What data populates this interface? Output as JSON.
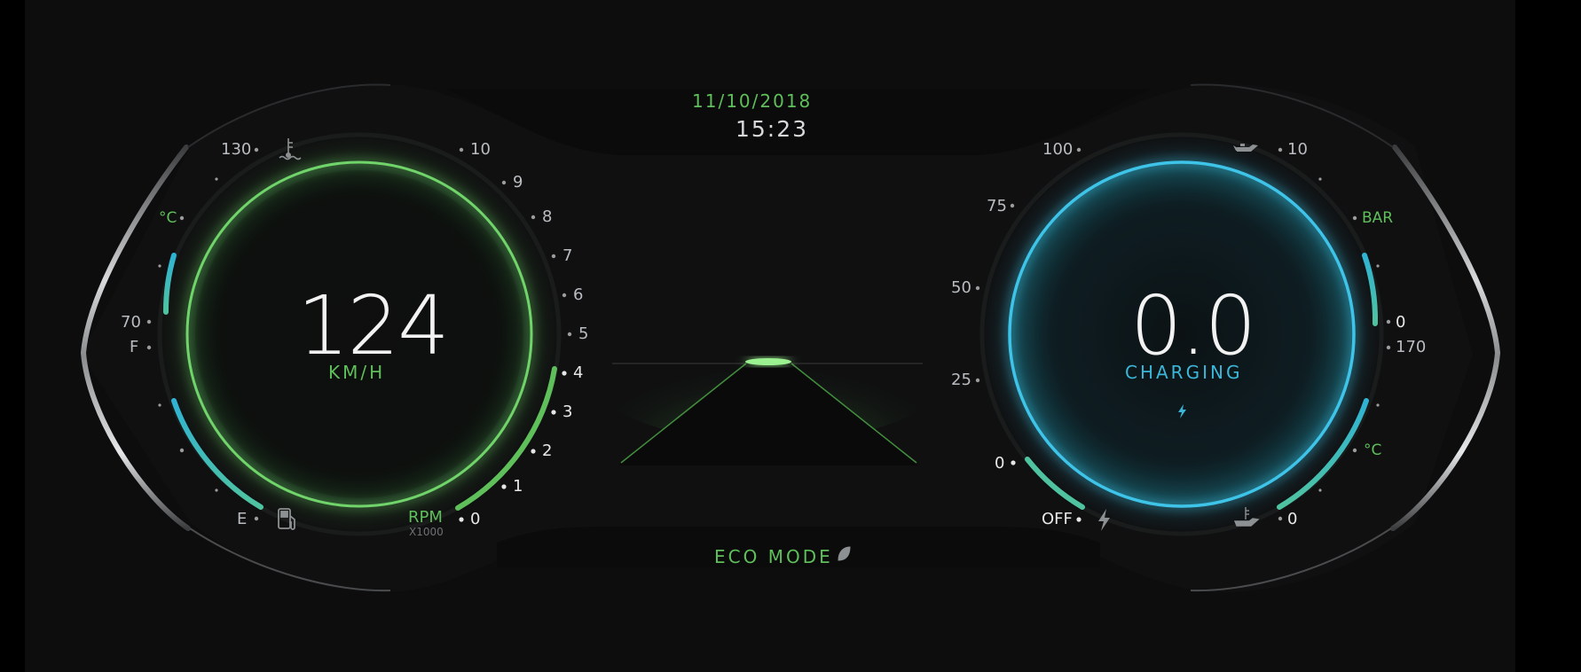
{
  "header": {
    "date": "11/10/2018",
    "time": "15:23"
  },
  "footer": {
    "mode": "ECO MODE",
    "mode_icon": "leaf-icon"
  },
  "left_cluster": {
    "speed_value": "124",
    "speed_unit": "KM/H",
    "temp_gauge": {
      "max_label": "130",
      "unit": "°C",
      "min_label": "70",
      "icon": "coolant-temperature-icon"
    },
    "fuel_gauge": {
      "full_label": "F",
      "empty_label": "E",
      "icon": "fuel-pump-icon"
    },
    "rpm_gauge": {
      "ticks": [
        "10",
        "9",
        "8",
        "7",
        "6",
        "5",
        "4",
        "3",
        "2",
        "1",
        "0"
      ],
      "label": "RPM",
      "multiplier": "X1000",
      "current_rpm_thousands": 4
    }
  },
  "right_cluster": {
    "value": "0.0",
    "status": "CHARGING",
    "status_icon": "lightning-icon",
    "power_gauge": {
      "ticks": [
        "100",
        "75",
        "50",
        "25",
        "0"
      ],
      "off_label": "OFF",
      "icon": "lightning-icon"
    },
    "oil_pressure_gauge": {
      "max_label": "10",
      "unit": "BAR",
      "min_label": "0",
      "icon": "oil-can-icon"
    },
    "oil_temp_gauge": {
      "max_label": "170",
      "unit": "°C",
      "min_label": "0",
      "icon": "oil-temperature-icon"
    }
  },
  "colors": {
    "accent_green": "#5fbf5a",
    "accent_blue": "#3cb6d8",
    "background": "#0d0d0e"
  }
}
